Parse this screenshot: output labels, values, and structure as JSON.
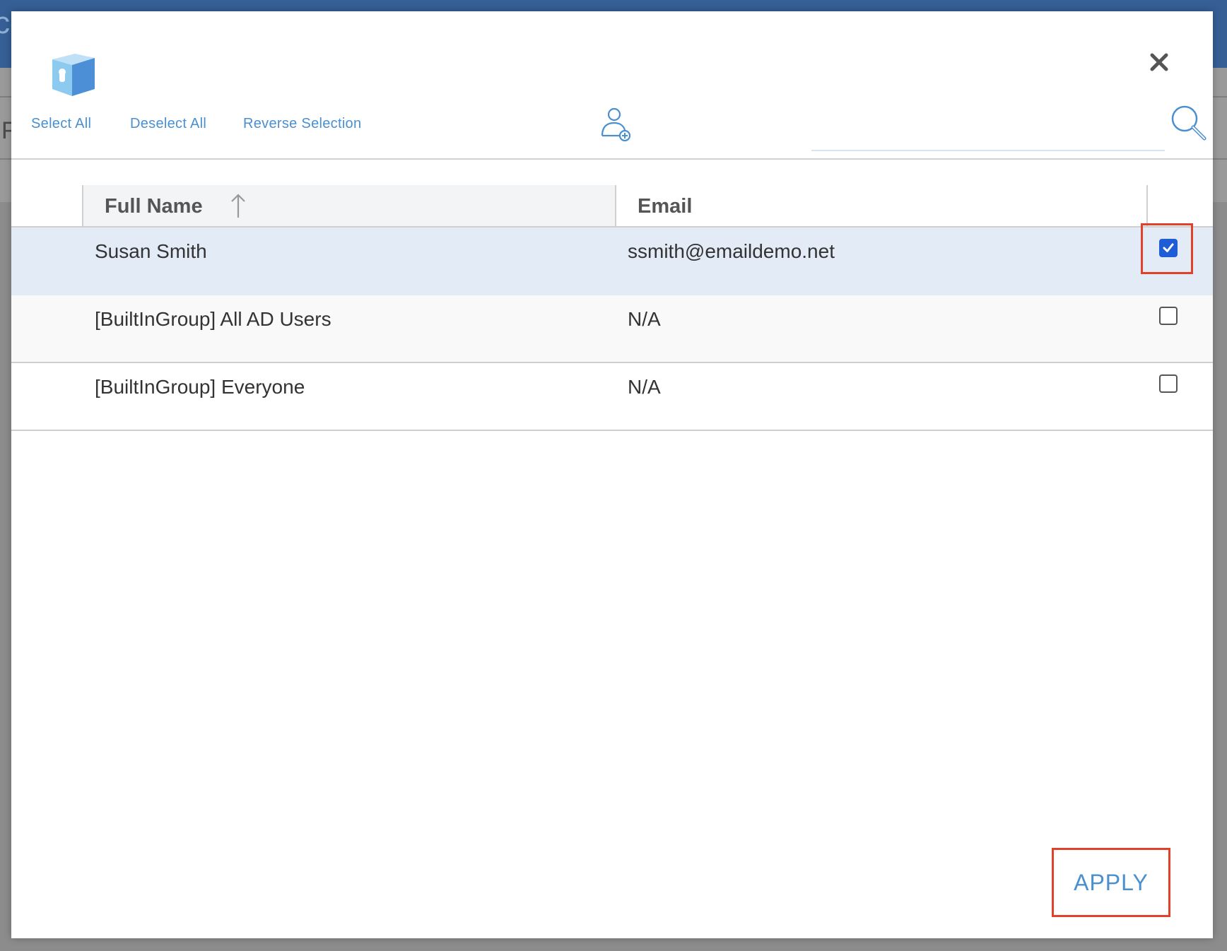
{
  "background": {
    "header_letters": "co",
    "side_letter": "F"
  },
  "toolbar": {
    "select_all": "Select All",
    "deselect_all": "Deselect All",
    "reverse_selection": "Reverse Selection",
    "add_user_icon": "user-add-icon",
    "search_icon": "search-icon",
    "search_value": "",
    "close_icon": "close-icon"
  },
  "table": {
    "columns": [
      {
        "label": "Full Name",
        "sort": "ascending"
      },
      {
        "label": "Email"
      },
      {
        "label": ""
      }
    ],
    "rows": [
      {
        "name": "Susan Smith",
        "email": "ssmith@emaildemo.net",
        "checked": true
      },
      {
        "name": "[BuiltInGroup] All AD Users",
        "email": "N/A",
        "checked": false
      },
      {
        "name": "[BuiltInGroup] Everyone",
        "email": "N/A",
        "checked": false
      }
    ]
  },
  "footer": {
    "apply_label": "APPLY"
  },
  "colors": {
    "accent": "#4a8fd0",
    "checkbox_checked": "#1f5dd6",
    "highlight": "#e0412a",
    "selected_row": "#e2ebf6"
  }
}
